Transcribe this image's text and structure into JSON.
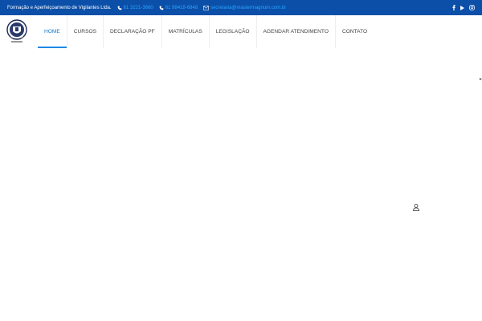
{
  "topbar": {
    "company": "Formação e Aperfeiçoamento de Vigilantes Ltda.",
    "phone1": "61 3221-3660",
    "phone2": "61 98418-6848",
    "email": "secretaria@mastermagnum.com.br",
    "social": [
      "facebook-icon",
      "youtube-icon",
      "instagram-icon"
    ]
  },
  "nav": {
    "items": [
      {
        "label": "HOME",
        "active": true
      },
      {
        "label": "CURSOS"
      },
      {
        "label": "DECLARAÇÃO PF"
      },
      {
        "label": "MATRÍCULAS"
      },
      {
        "label": "LEGISLAÇÃO"
      },
      {
        "label": "AGENDAR ATENDIMENTO"
      },
      {
        "label": "CONTATO"
      }
    ]
  },
  "colors": {
    "topbar": "#0b4fa8",
    "link": "#2aa6ff",
    "active": "#1e88e5"
  }
}
